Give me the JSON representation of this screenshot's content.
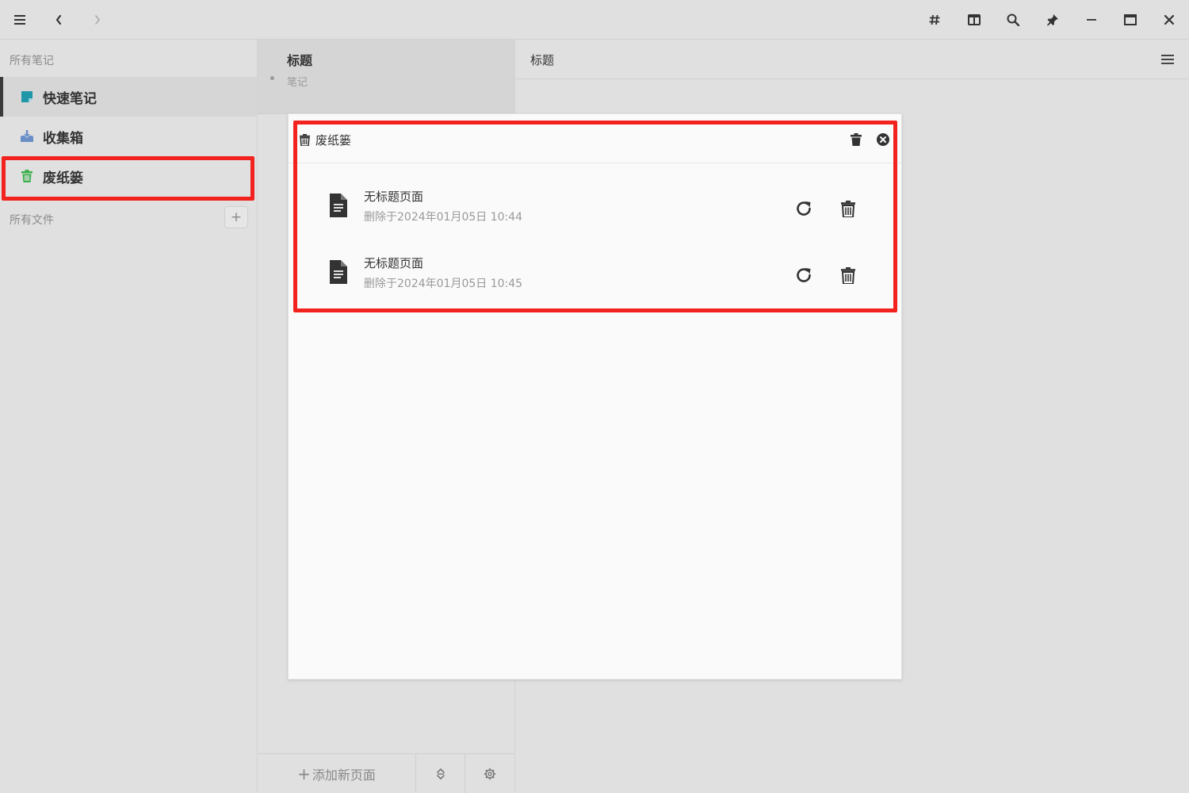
{
  "topbar": {
    "icons": [
      "menu-icon",
      "back-icon",
      "forward-icon",
      "hash-icon",
      "columns-icon",
      "search-icon",
      "pin-icon",
      "minimize-icon",
      "maximize-icon",
      "close-icon"
    ]
  },
  "sidebar": {
    "all_notes_label": "所有笔记",
    "items": [
      {
        "label": "快速笔记",
        "icon": "sticky-note-icon",
        "icon_color": "#2196a8"
      },
      {
        "label": "收集箱",
        "icon": "inbox-icon",
        "icon_color": "#6a8fc7"
      },
      {
        "label": "废纸篓",
        "icon": "trash-icon",
        "icon_color": "#3bb04a"
      }
    ],
    "all_files_label": "所有文件",
    "add_button_label": "+"
  },
  "middle": {
    "note": {
      "title": "标题",
      "tag": "笔记"
    },
    "footer": {
      "add_page_label": "添加新页面",
      "add_page_plus": "+"
    }
  },
  "right": {
    "title": "标题"
  },
  "trash_dialog": {
    "title": "废纸篓",
    "items": [
      {
        "title": "无标题页面",
        "deleted_at": "删除于2024年01月05日 10:44"
      },
      {
        "title": "无标题页面",
        "deleted_at": "删除于2024年01月05日 10:45"
      }
    ]
  },
  "colors": {
    "highlight": "#f2231f",
    "background": "#e0e0e0",
    "dialog_background": "#fafafa"
  }
}
